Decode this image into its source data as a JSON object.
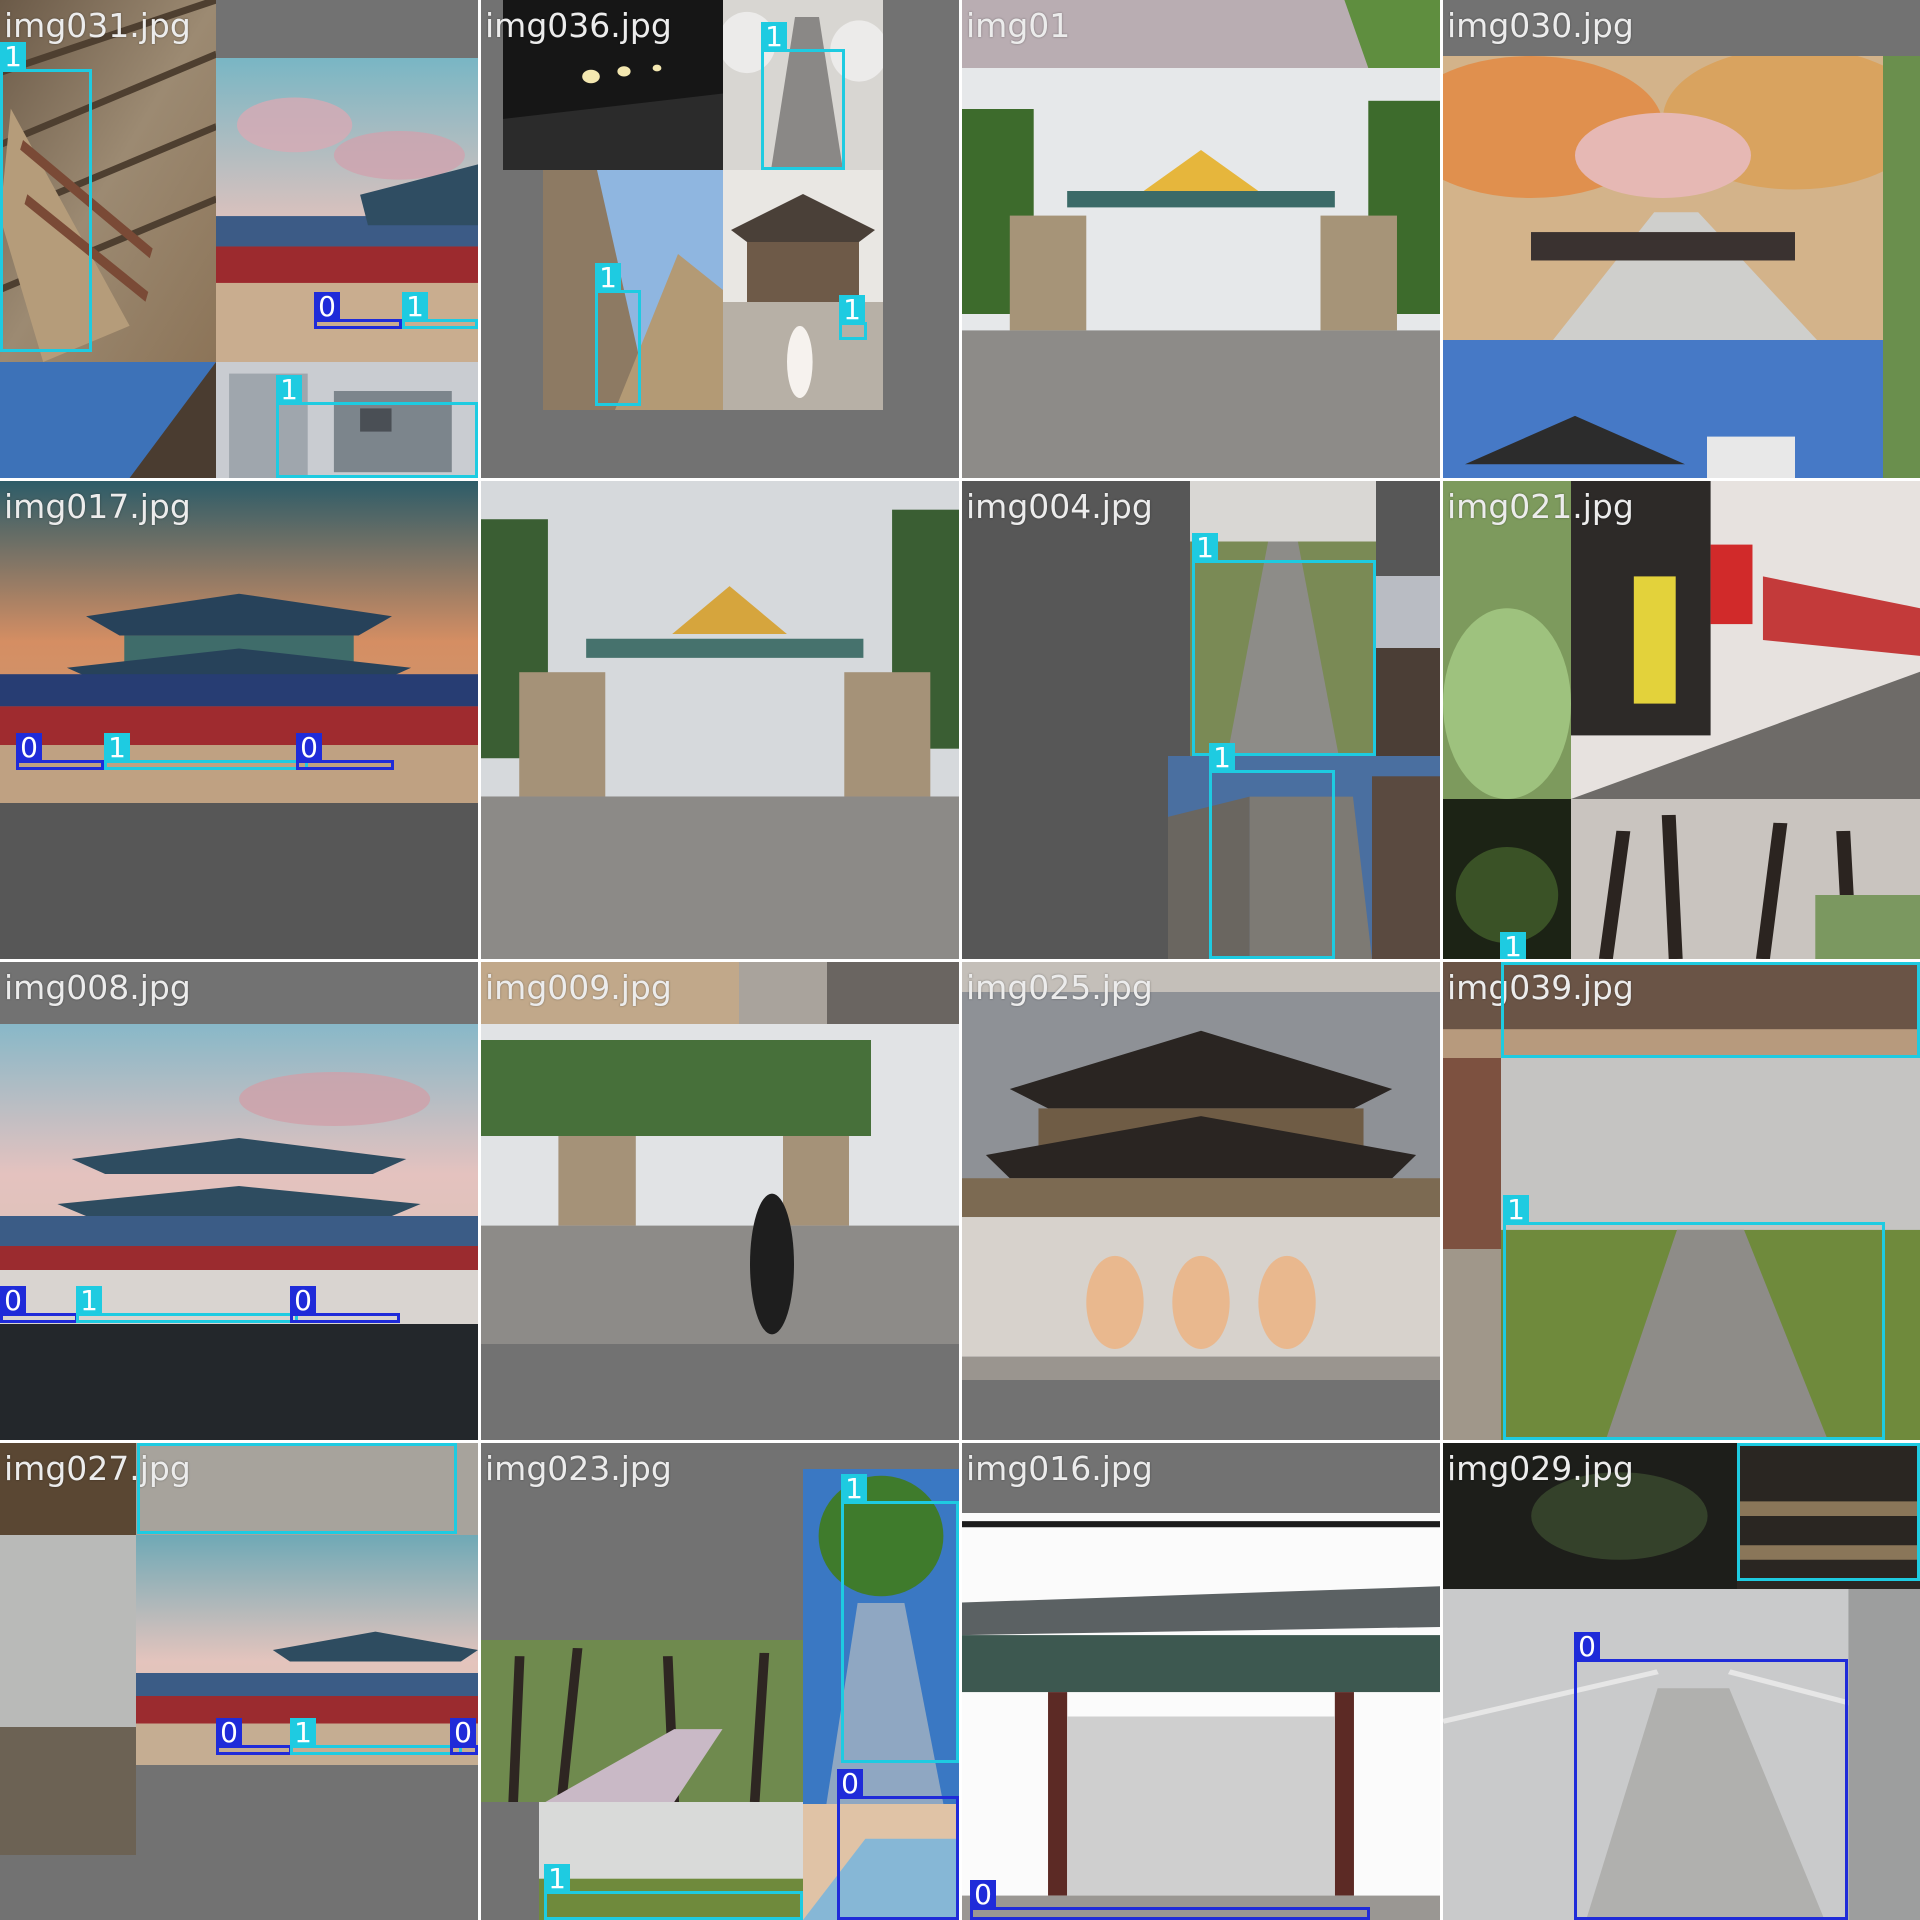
{
  "title": "",
  "colors": {
    "class_0": "#1f2bd9",
    "class_1": "#1ecbe1",
    "padding": "#727272",
    "label_text": "#ececec"
  },
  "tiles": [
    {
      "filename": "img031.jpg",
      "detections": [
        {
          "label": "1"
        },
        {
          "label": "0"
        },
        {
          "label": "1"
        },
        {
          "label": "1"
        }
      ]
    },
    {
      "filename": "img036.jpg",
      "detections": [
        {
          "label": "1"
        },
        {
          "label": "1"
        },
        {
          "label": "1"
        }
      ]
    },
    {
      "filename": "img01",
      "detections": []
    },
    {
      "filename": "img030.jpg",
      "detections": []
    },
    {
      "filename": "img017.jpg",
      "detections": [
        {
          "label": "0"
        },
        {
          "label": "1"
        },
        {
          "label": "0"
        }
      ]
    },
    {
      "filename": "",
      "detections": []
    },
    {
      "filename": "img004.jpg",
      "detections": [
        {
          "label": "1"
        },
        {
          "label": "1"
        }
      ]
    },
    {
      "filename": "img021.jpg",
      "detections": [
        {
          "label": "1"
        }
      ]
    },
    {
      "filename": "img008.jpg",
      "detections": [
        {
          "label": "0"
        },
        {
          "label": "1"
        },
        {
          "label": "0"
        }
      ]
    },
    {
      "filename": "img009.jpg",
      "detections": []
    },
    {
      "filename": "img025.jpg",
      "detections": []
    },
    {
      "filename": "img039.jpg",
      "detections": [
        {
          "label": "1"
        },
        {
          "label": "1"
        }
      ]
    },
    {
      "filename": "img027.jpg",
      "detections": [
        {
          "label": "1"
        },
        {
          "label": "0"
        },
        {
          "label": "1"
        },
        {
          "label": "0"
        }
      ]
    },
    {
      "filename": "img023.jpg",
      "detections": [
        {
          "label": "1"
        },
        {
          "label": "0"
        },
        {
          "label": "1"
        }
      ]
    },
    {
      "filename": "img016.jpg",
      "detections": [
        {
          "label": "0"
        }
      ]
    },
    {
      "filename": "img029.jpg",
      "detections": [
        {
          "label": "1"
        },
        {
          "label": "0"
        }
      ]
    }
  ]
}
